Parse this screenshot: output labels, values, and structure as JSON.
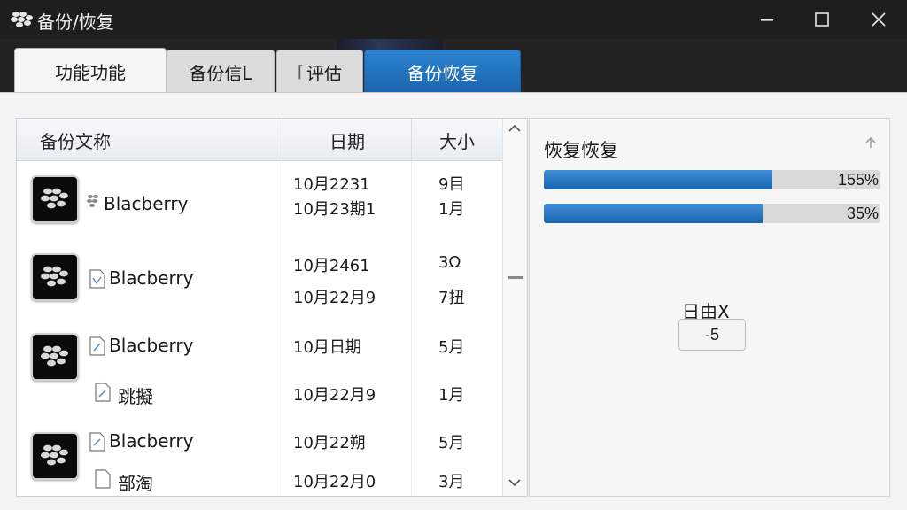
{
  "window": {
    "title": "备份/恢复",
    "controls": [
      "minimize-icon",
      "maximize-icon",
      "close-icon"
    ]
  },
  "tabs": [
    {
      "label": "功能功能",
      "active": false
    },
    {
      "label": "备份信L",
      "active": false
    },
    {
      "label": "评估",
      "icon": "partial-icon",
      "active": false
    },
    {
      "label": "备份恢复",
      "active": true
    }
  ],
  "backup_list": {
    "columns": [
      "备份文称",
      "日期",
      "大小"
    ],
    "rows": [
      {
        "name": "Blacberry",
        "icon": "blackberry-icon",
        "dates": [
          "10月2231",
          "10月23期1"
        ],
        "sizes": [
          "9目",
          "1月"
        ]
      },
      {
        "name": "Blacberry",
        "icon": "blackberry-icon",
        "dates": [
          "10月2461",
          "10月22月9"
        ],
        "sizes": [
          "3Ω",
          "7扭"
        ]
      },
      {
        "name": "Blacberry",
        "icon": "blackberry-icon",
        "subname": "跳擬",
        "dates": [
          "10月日期",
          "10月22月9"
        ],
        "sizes": [
          "5月",
          "1月"
        ]
      },
      {
        "name": "Blacberry",
        "icon": "blackberry-icon",
        "subname": "部淘",
        "dates": [
          "10月22朔",
          "10月22月0"
        ],
        "sizes": [
          "5月",
          "3月"
        ]
      }
    ]
  },
  "restore": {
    "title": "恢复恢复",
    "progress": [
      {
        "label": "155%",
        "fraction": 0.68
      },
      {
        "label": "35%",
        "fraction": 0.65
      }
    ],
    "x_label": "日由X",
    "x_value": "-5"
  },
  "colors": {
    "accent": "#1b6fc0",
    "titlebar": "#1e1e1e",
    "panel": "#f3f3f3"
  }
}
